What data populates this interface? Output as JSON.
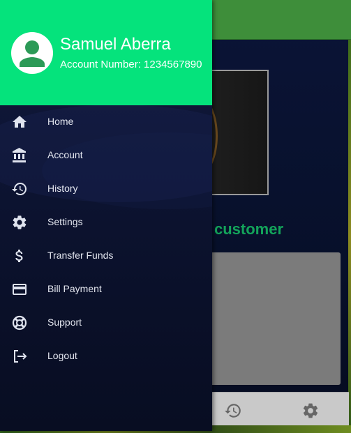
{
  "background": {
    "welcome_fragment": "customer",
    "card_fragment": "-",
    "bottom_nav": [
      {
        "icon": "history-icon"
      },
      {
        "icon": "settings-icon"
      }
    ]
  },
  "drawer": {
    "user": {
      "name": "Samuel Aberra",
      "account_number": "Account Number: 1234567890",
      "avatar_icon": "person-icon"
    },
    "header_color": "#05e37c",
    "items": [
      {
        "label": "Home",
        "icon": "home-icon"
      },
      {
        "label": "Account",
        "icon": "bank-icon"
      },
      {
        "label": "History",
        "icon": "history-icon"
      },
      {
        "label": "Settings",
        "icon": "gear-icon"
      },
      {
        "label": "Transfer Funds",
        "icon": "dollar-icon"
      },
      {
        "label": "Bill Payment",
        "icon": "credit-card-icon"
      },
      {
        "label": "Support",
        "icon": "lifebuoy-icon"
      },
      {
        "label": "Logout",
        "icon": "logout-icon"
      }
    ]
  }
}
